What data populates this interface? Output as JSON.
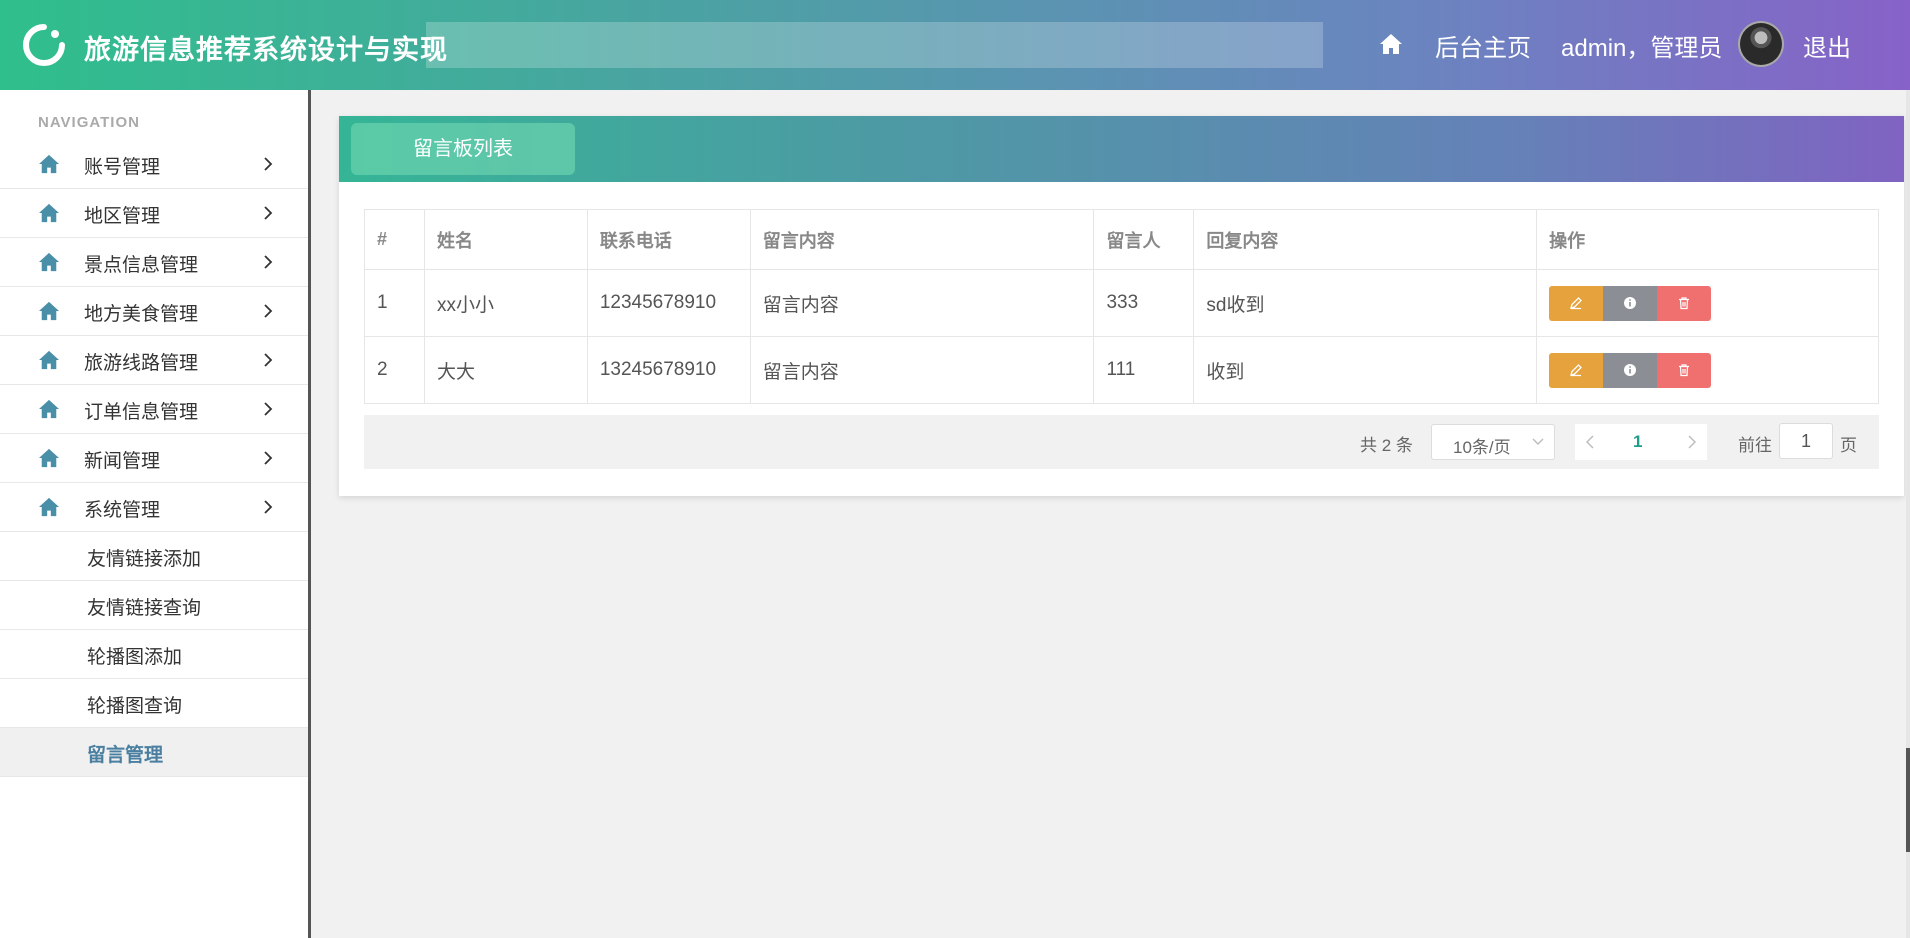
{
  "header": {
    "title": "旅游信息推荐系统设计与实现",
    "home_icon": "home-icon",
    "admin_home": "后台主页",
    "user": "admin，管理员",
    "logout": "退出"
  },
  "sidebar": {
    "heading": "NAVIGATION",
    "items": [
      {
        "label": "账号管理",
        "icon": "home-icon"
      },
      {
        "label": "地区管理",
        "icon": "home-icon"
      },
      {
        "label": "景点信息管理",
        "icon": "home-icon"
      },
      {
        "label": "地方美食管理",
        "icon": "home-icon"
      },
      {
        "label": "旅游线路管理",
        "icon": "home-icon"
      },
      {
        "label": "订单信息管理",
        "icon": "home-icon"
      },
      {
        "label": "新闻管理",
        "icon": "home-icon"
      },
      {
        "label": "系统管理",
        "icon": "home-icon"
      }
    ],
    "subitems": [
      {
        "label": "友情链接添加"
      },
      {
        "label": "友情链接查询"
      },
      {
        "label": "轮播图添加"
      },
      {
        "label": "轮播图查询"
      },
      {
        "label": "留言管理",
        "active": true
      }
    ]
  },
  "panel": {
    "tab": "留言板列表",
    "columns": [
      "#",
      "姓名",
      "联系电话",
      "留言内容",
      "留言人",
      "回复内容",
      "操作"
    ],
    "rows": [
      {
        "no": "1",
        "name": "xx小小",
        "phone": "12345678910",
        "content": "留言内容",
        "author": "333",
        "reply": "sd收到"
      },
      {
        "no": "2",
        "name": "大大",
        "phone": "13245678910",
        "content": "留言内容",
        "author": "111",
        "reply": "收到"
      }
    ],
    "actions": {
      "edit_icon": "edit-icon",
      "info_icon": "info-icon",
      "delete_icon": "trash-icon"
    },
    "colors": {
      "edit": "#e6a23c",
      "info": "#8b8f95",
      "delete": "#f07070"
    }
  },
  "pagination": {
    "total": "共 2 条",
    "page_size": "10条/页",
    "current": "1",
    "goto_label": "前往",
    "goto_value": "1",
    "page_unit": "页"
  },
  "colors": {
    "header_start": "#2fbf8c",
    "header_end": "#8762c8",
    "active_menu": "#4a7fa0"
  }
}
